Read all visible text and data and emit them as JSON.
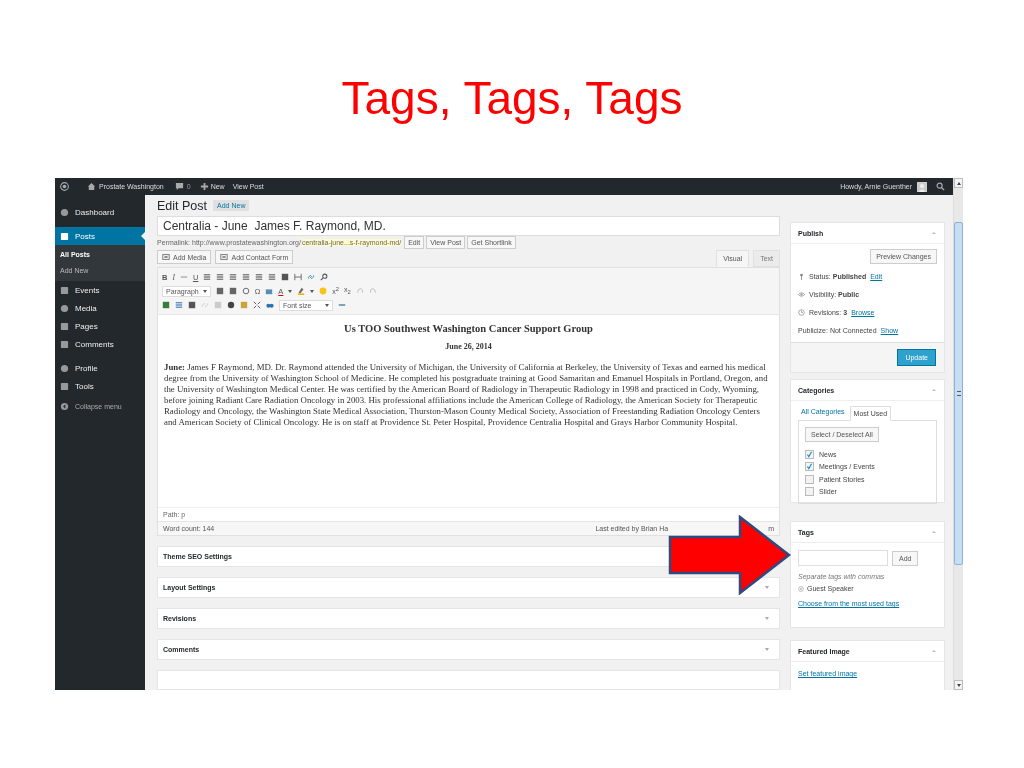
{
  "slide": {
    "title": "Tags, Tags, Tags"
  },
  "admin_bar": {
    "site": "Prostate Washington",
    "comments": "0",
    "new": "New",
    "view_post": "View Post",
    "greeting": "Howdy, Arnie Guenther"
  },
  "admin_menu": [
    {
      "label": "Dashboard",
      "selected": false
    },
    {
      "label": "Posts",
      "selected": true,
      "submenu": [
        {
          "label": "All Posts",
          "selected": true
        },
        {
          "label": "Add New",
          "selected": false
        }
      ]
    },
    {
      "label": "Events",
      "selected": false
    },
    {
      "label": "Media",
      "selected": false
    },
    {
      "label": "Pages",
      "selected": false
    },
    {
      "label": "Comments",
      "selected": false
    },
    {
      "label": "Profile",
      "selected": false
    },
    {
      "label": "Tools",
      "selected": false
    }
  ],
  "collapse_menu": "Collapse menu",
  "page": {
    "heading": "Edit Post",
    "add_new": "Add New"
  },
  "title_field": {
    "value": "Centralia - June  James F. Raymond, MD."
  },
  "permalink": {
    "label": "Permalink: http://www.prostatewashington.org/",
    "slug": "centralia-june...s-f-raymond-md/",
    "buttons": [
      "Edit",
      "View Post",
      "Get Shortlink"
    ]
  },
  "media_buttons": [
    "Add Media",
    "Add Contact Form"
  ],
  "editor_tabs": [
    {
      "label": "Visual",
      "selected": true
    },
    {
      "label": "Text",
      "selected": false
    }
  ],
  "toolbar": {
    "row1": [
      "B",
      "I",
      "U"
    ],
    "format": "Paragraph",
    "row2": [
      "Ω",
      "A",
      "x$^{2}$",
      "x$_{2}$"
    ],
    "font_size": "Font size"
  },
  "content": {
    "heading": "Us TOO Southwest Washington Cancer Support Group",
    "date": "June 26, 2014",
    "body": "**June:**  James F Raymond, MD.  Dr. Raymond attended the University of Michigan, the University of California at Berkeley, the University of Texas and earned his medical degree from the University of Washington School of Medicine. He completed his postgraduate training at Good Samaritan and Emanuel Hospitals in Portland, Oregon, and the University of Washington Medical Center. He was certified by the American Board of Radiology in Therapeutic Radiology in 1998 and practiced in Cody, Wyoming, before joining Radiant Care Radiation Oncology in 2003. His professional affiliations include the American College of Radiology, the American Society for Therapeutic Radiology and Oncology, the Washington State Medical Association, Thurston-Mason County Medical Society, Association of Freestanding Radiation Oncology Centers and American Society of Clinical Oncology. He is on staff at Providence St. Peter Hospital, Providence Centralia Hospital and Grays Harbor Community Hospital."
  },
  "status": {
    "path": "Path: p",
    "word_count": "Word count: 144",
    "last_edited": "Last edited by Brian Ha",
    "last_edited_tail": "m"
  },
  "postboxes": [
    {
      "title": "Theme SEO Settings"
    },
    {
      "title": "Layout Settings"
    },
    {
      "title": "Revisions"
    },
    {
      "title": "Comments"
    }
  ],
  "publish": {
    "title": "Publish",
    "preview": "Preview Changes",
    "rows": [
      {
        "kind": "status",
        "text": "Status: **Published**",
        "link": "Edit"
      },
      {
        "kind": "visibility",
        "text": "Visibility: **Public**"
      },
      {
        "kind": "revisions",
        "text": "Revisions: **3**",
        "link": "Browse"
      },
      {
        "kind": "publicize",
        "text": "Publicize: Not Connected",
        "link": "Show"
      }
    ],
    "update": "Update"
  },
  "categories": {
    "title": "Categories",
    "tabs": [
      {
        "label": "All Categories",
        "selected": false
      },
      {
        "label": "Most Used",
        "selected": true
      }
    ],
    "select_all": "Select / Deselect All",
    "items": [
      {
        "label": "News",
        "checked": true
      },
      {
        "label": "Meetings / Events",
        "checked": true
      },
      {
        "label": "Patient Stories",
        "checked": false
      },
      {
        "label": "Slider",
        "checked": false
      }
    ]
  },
  "tags": {
    "title": "Tags",
    "add": "Add",
    "hint": "Separate tags with commas",
    "items": [
      "Guest Speaker"
    ],
    "choose": "Choose from the most used tags"
  },
  "featured_image": {
    "title": "Featured Image",
    "link": "Set featured image"
  }
}
